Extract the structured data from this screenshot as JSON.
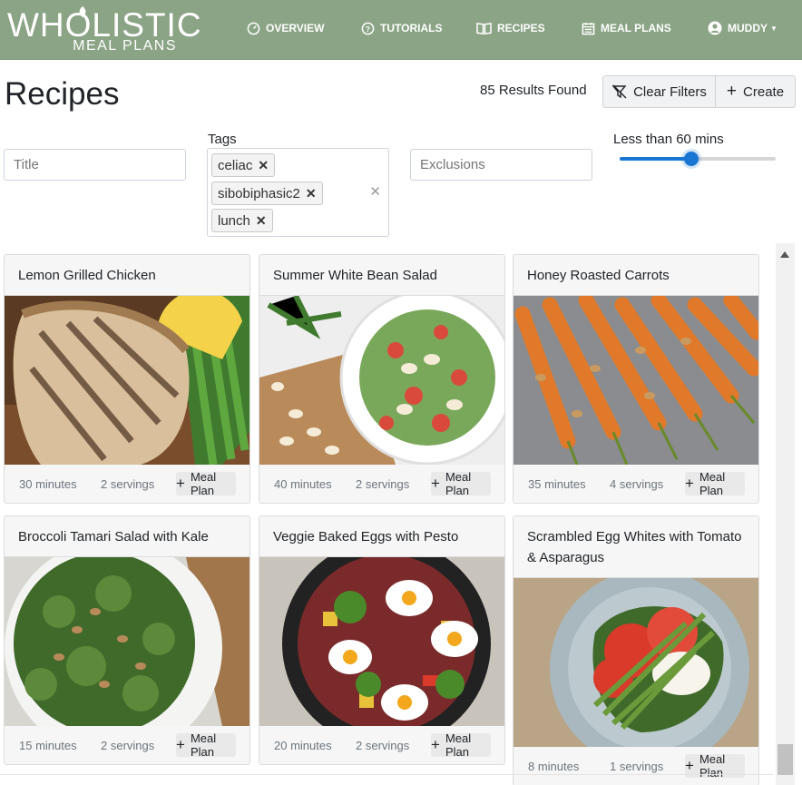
{
  "brand": {
    "name": "WHOLISTIC",
    "tagline": "MEAL PLANS",
    "color": "#8aa485"
  },
  "nav": {
    "items": [
      {
        "label": "OVERVIEW",
        "icon": "dashboard-icon"
      },
      {
        "label": "TUTORIALS",
        "icon": "question-circle-icon"
      },
      {
        "label": "RECIPES",
        "icon": "book-icon"
      },
      {
        "label": "MEAL PLANS",
        "icon": "calendar-icon"
      }
    ],
    "user": "MUDDY"
  },
  "page": {
    "title": "Recipes",
    "results": "85 Results Found",
    "clear_filters": "Clear Filters",
    "create": "Create"
  },
  "filters": {
    "title_placeholder": "Title",
    "tags_label": "Tags",
    "tags": [
      "celiac",
      "sibobiphasic2",
      "lunch"
    ],
    "exclusions_placeholder": "Exclusions",
    "time_label": "Less than 60 mins",
    "time_slider_fraction": 0.46
  },
  "recipes": [
    {
      "title": "Lemon Grilled Chicken",
      "time": "30 minutes",
      "servings": "2 servings",
      "button": "Meal Plan",
      "image": "grilled-chicken-photo"
    },
    {
      "title": "Summer White Bean Salad",
      "time": "40 minutes",
      "servings": "2 servings",
      "button": "Meal Plan",
      "image": "bean-salad-photo"
    },
    {
      "title": "Honey Roasted Carrots",
      "time": "35 minutes",
      "servings": "4 servings",
      "button": "Meal Plan",
      "image": "roasted-carrots-photo"
    },
    {
      "title": "Broccoli Tamari Salad with Kale",
      "time": "15 minutes",
      "servings": "2 servings",
      "button": "Meal Plan",
      "image": "broccoli-salad-photo"
    },
    {
      "title": "Veggie Baked Eggs with Pesto",
      "time": "20 minutes",
      "servings": "2 servings",
      "button": "Meal Plan",
      "image": "baked-eggs-photo"
    },
    {
      "title": "Scrambled Egg Whites with Tomato & Asparagus",
      "time": "8 minutes",
      "servings": "1 servings",
      "button": "Meal Plan",
      "image": "egg-whites-photo"
    }
  ]
}
